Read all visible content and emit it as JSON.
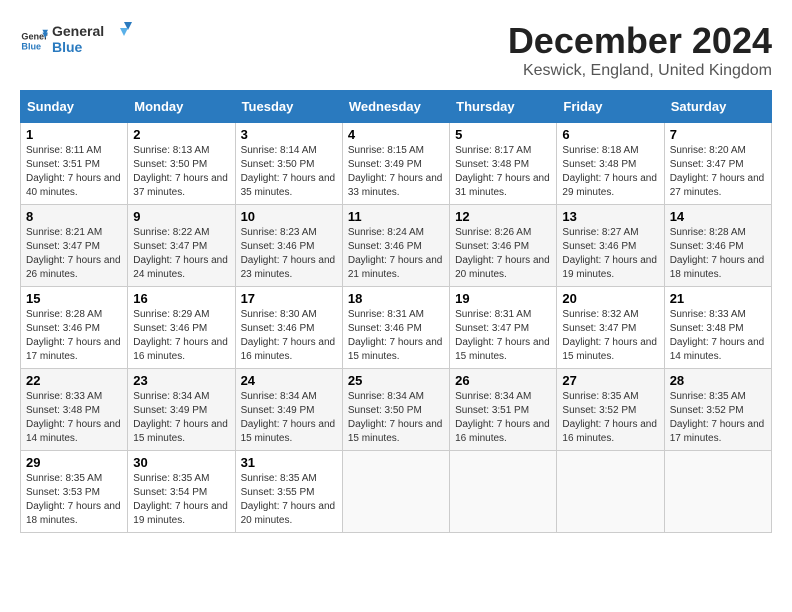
{
  "logo": {
    "general": "General",
    "blue": "Blue"
  },
  "title": "December 2024",
  "location": "Keswick, England, United Kingdom",
  "days_of_week": [
    "Sunday",
    "Monday",
    "Tuesday",
    "Wednesday",
    "Thursday",
    "Friday",
    "Saturday"
  ],
  "weeks": [
    [
      {
        "day": "1",
        "sunrise": "Sunrise: 8:11 AM",
        "sunset": "Sunset: 3:51 PM",
        "daylight": "Daylight: 7 hours and 40 minutes."
      },
      {
        "day": "2",
        "sunrise": "Sunrise: 8:13 AM",
        "sunset": "Sunset: 3:50 PM",
        "daylight": "Daylight: 7 hours and 37 minutes."
      },
      {
        "day": "3",
        "sunrise": "Sunrise: 8:14 AM",
        "sunset": "Sunset: 3:50 PM",
        "daylight": "Daylight: 7 hours and 35 minutes."
      },
      {
        "day": "4",
        "sunrise": "Sunrise: 8:15 AM",
        "sunset": "Sunset: 3:49 PM",
        "daylight": "Daylight: 7 hours and 33 minutes."
      },
      {
        "day": "5",
        "sunrise": "Sunrise: 8:17 AM",
        "sunset": "Sunset: 3:48 PM",
        "daylight": "Daylight: 7 hours and 31 minutes."
      },
      {
        "day": "6",
        "sunrise": "Sunrise: 8:18 AM",
        "sunset": "Sunset: 3:48 PM",
        "daylight": "Daylight: 7 hours and 29 minutes."
      },
      {
        "day": "7",
        "sunrise": "Sunrise: 8:20 AM",
        "sunset": "Sunset: 3:47 PM",
        "daylight": "Daylight: 7 hours and 27 minutes."
      }
    ],
    [
      {
        "day": "8",
        "sunrise": "Sunrise: 8:21 AM",
        "sunset": "Sunset: 3:47 PM",
        "daylight": "Daylight: 7 hours and 26 minutes."
      },
      {
        "day": "9",
        "sunrise": "Sunrise: 8:22 AM",
        "sunset": "Sunset: 3:47 PM",
        "daylight": "Daylight: 7 hours and 24 minutes."
      },
      {
        "day": "10",
        "sunrise": "Sunrise: 8:23 AM",
        "sunset": "Sunset: 3:46 PM",
        "daylight": "Daylight: 7 hours and 23 minutes."
      },
      {
        "day": "11",
        "sunrise": "Sunrise: 8:24 AM",
        "sunset": "Sunset: 3:46 PM",
        "daylight": "Daylight: 7 hours and 21 minutes."
      },
      {
        "day": "12",
        "sunrise": "Sunrise: 8:26 AM",
        "sunset": "Sunset: 3:46 PM",
        "daylight": "Daylight: 7 hours and 20 minutes."
      },
      {
        "day": "13",
        "sunrise": "Sunrise: 8:27 AM",
        "sunset": "Sunset: 3:46 PM",
        "daylight": "Daylight: 7 hours and 19 minutes."
      },
      {
        "day": "14",
        "sunrise": "Sunrise: 8:28 AM",
        "sunset": "Sunset: 3:46 PM",
        "daylight": "Daylight: 7 hours and 18 minutes."
      }
    ],
    [
      {
        "day": "15",
        "sunrise": "Sunrise: 8:28 AM",
        "sunset": "Sunset: 3:46 PM",
        "daylight": "Daylight: 7 hours and 17 minutes."
      },
      {
        "day": "16",
        "sunrise": "Sunrise: 8:29 AM",
        "sunset": "Sunset: 3:46 PM",
        "daylight": "Daylight: 7 hours and 16 minutes."
      },
      {
        "day": "17",
        "sunrise": "Sunrise: 8:30 AM",
        "sunset": "Sunset: 3:46 PM",
        "daylight": "Daylight: 7 hours and 16 minutes."
      },
      {
        "day": "18",
        "sunrise": "Sunrise: 8:31 AM",
        "sunset": "Sunset: 3:46 PM",
        "daylight": "Daylight: 7 hours and 15 minutes."
      },
      {
        "day": "19",
        "sunrise": "Sunrise: 8:31 AM",
        "sunset": "Sunset: 3:47 PM",
        "daylight": "Daylight: 7 hours and 15 minutes."
      },
      {
        "day": "20",
        "sunrise": "Sunrise: 8:32 AM",
        "sunset": "Sunset: 3:47 PM",
        "daylight": "Daylight: 7 hours and 15 minutes."
      },
      {
        "day": "21",
        "sunrise": "Sunrise: 8:33 AM",
        "sunset": "Sunset: 3:48 PM",
        "daylight": "Daylight: 7 hours and 14 minutes."
      }
    ],
    [
      {
        "day": "22",
        "sunrise": "Sunrise: 8:33 AM",
        "sunset": "Sunset: 3:48 PM",
        "daylight": "Daylight: 7 hours and 14 minutes."
      },
      {
        "day": "23",
        "sunrise": "Sunrise: 8:34 AM",
        "sunset": "Sunset: 3:49 PM",
        "daylight": "Daylight: 7 hours and 15 minutes."
      },
      {
        "day": "24",
        "sunrise": "Sunrise: 8:34 AM",
        "sunset": "Sunset: 3:49 PM",
        "daylight": "Daylight: 7 hours and 15 minutes."
      },
      {
        "day": "25",
        "sunrise": "Sunrise: 8:34 AM",
        "sunset": "Sunset: 3:50 PM",
        "daylight": "Daylight: 7 hours and 15 minutes."
      },
      {
        "day": "26",
        "sunrise": "Sunrise: 8:34 AM",
        "sunset": "Sunset: 3:51 PM",
        "daylight": "Daylight: 7 hours and 16 minutes."
      },
      {
        "day": "27",
        "sunrise": "Sunrise: 8:35 AM",
        "sunset": "Sunset: 3:52 PM",
        "daylight": "Daylight: 7 hours and 16 minutes."
      },
      {
        "day": "28",
        "sunrise": "Sunrise: 8:35 AM",
        "sunset": "Sunset: 3:52 PM",
        "daylight": "Daylight: 7 hours and 17 minutes."
      }
    ],
    [
      {
        "day": "29",
        "sunrise": "Sunrise: 8:35 AM",
        "sunset": "Sunset: 3:53 PM",
        "daylight": "Daylight: 7 hours and 18 minutes."
      },
      {
        "day": "30",
        "sunrise": "Sunrise: 8:35 AM",
        "sunset": "Sunset: 3:54 PM",
        "daylight": "Daylight: 7 hours and 19 minutes."
      },
      {
        "day": "31",
        "sunrise": "Sunrise: 8:35 AM",
        "sunset": "Sunset: 3:55 PM",
        "daylight": "Daylight: 7 hours and 20 minutes."
      },
      null,
      null,
      null,
      null
    ]
  ]
}
